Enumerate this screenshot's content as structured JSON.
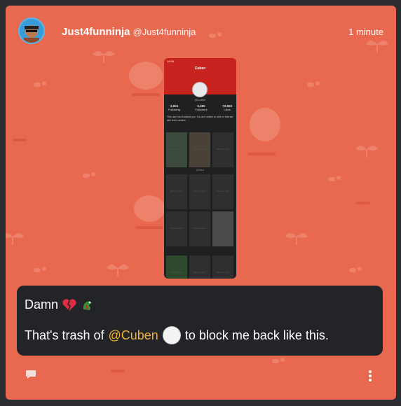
{
  "post": {
    "display_name": "Just4funninja",
    "handle": "@Just4funninja",
    "timestamp": "1 minute"
  },
  "screenshot": {
    "status": "14:08",
    "profile_title": "Cuben",
    "username": "@Cuben",
    "stats": [
      {
        "value": "3,804",
        "label": "Following"
      },
      {
        "value": "5,380",
        "label": "Followers"
      },
      {
        "value": "70,859",
        "label": "Likes"
      }
    ],
    "notice": "This user has blocked you. You are unable to view or interact with their content.",
    "tile_label": "Blocked user",
    "separator": "pinned"
  },
  "message": {
    "line1_text": "Damn",
    "line2_prefix": "That's trash of",
    "mention": "@Cuben",
    "line2_suffix": "to block me back like this."
  },
  "icons": [
    "broken-heart-icon",
    "dragon-emoji-icon",
    "comment-icon",
    "more-options-icon"
  ],
  "colors": {
    "background": "#e8694f",
    "mention": "#f0b232",
    "message_bg": "#232428"
  }
}
